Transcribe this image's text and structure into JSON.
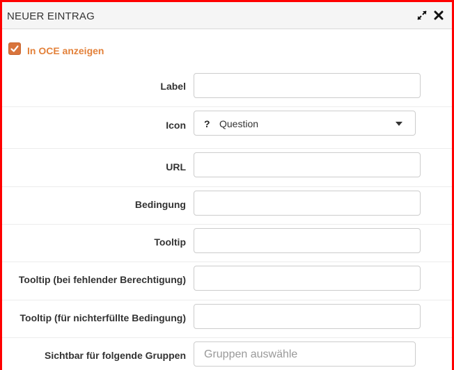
{
  "dialog": {
    "title": "NEUER EINTRAG",
    "expand_icon": "expand-arrows-icon",
    "close_icon": "close-x-icon"
  },
  "show_in_oce": {
    "label": "In OCE anzeigen",
    "checked": true
  },
  "form": {
    "label": {
      "label": "Label",
      "value": ""
    },
    "icon": {
      "label": "Icon",
      "glyph": "?",
      "value": "Question"
    },
    "url": {
      "label": "URL",
      "value": ""
    },
    "condition": {
      "label": "Bedingung",
      "value": ""
    },
    "tooltip": {
      "label": "Tooltip",
      "value": ""
    },
    "tooltip_no_permission": {
      "label": "Tooltip (bei fehlender Berechtigung)",
      "value": ""
    },
    "tooltip_unmet_condition": {
      "label": "Tooltip (für nichterfüllte Bedingung)",
      "value": ""
    },
    "visible_groups": {
      "label": "Sichtbar für folgende Gruppen",
      "placeholder": "Gruppen auswähle"
    }
  },
  "colors": {
    "accent": "#e3813a",
    "frame_border": "#ff0000"
  }
}
